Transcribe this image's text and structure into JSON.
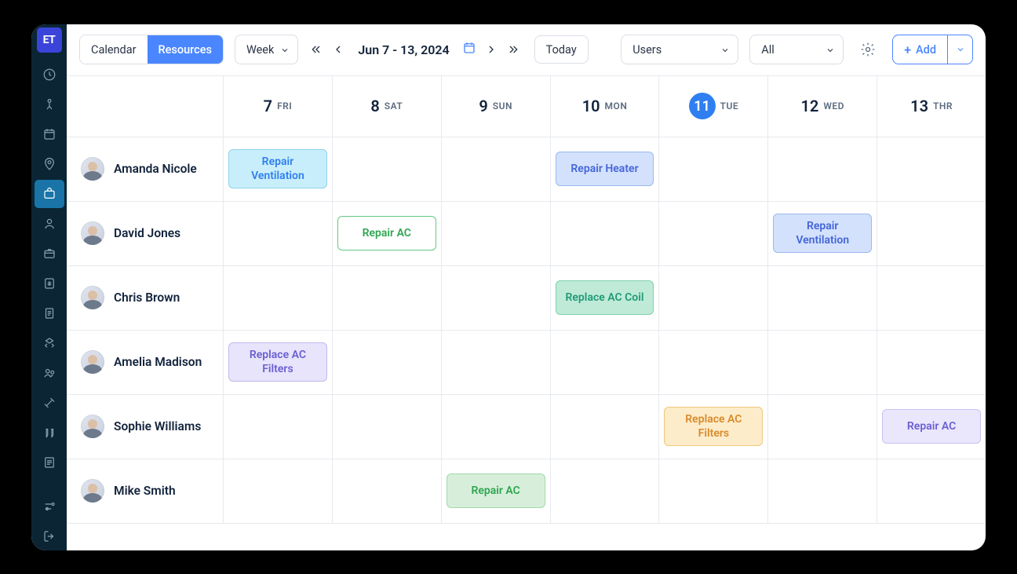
{
  "brand": "ET",
  "viewToggle": {
    "calendar": "Calendar",
    "resources": "Resources"
  },
  "rangeSelector": "Week",
  "dateRange": "Jun 7 - 13, 2024",
  "todayLabel": "Today",
  "filter1": "Users",
  "filter2": "All",
  "addLabel": "Add",
  "days": [
    {
      "num": "7",
      "lbl": "FRI",
      "today": false
    },
    {
      "num": "8",
      "lbl": "SAT",
      "today": false
    },
    {
      "num": "9",
      "lbl": "SUN",
      "today": false
    },
    {
      "num": "10",
      "lbl": "MON",
      "today": false
    },
    {
      "num": "11",
      "lbl": "TUE",
      "today": true
    },
    {
      "num": "12",
      "lbl": "WED",
      "today": false
    },
    {
      "num": "13",
      "lbl": "THR",
      "today": false
    }
  ],
  "rows": [
    {
      "name": "Amanda Nicole",
      "cells": [
        {
          "label": "Repair Ventilation",
          "style": "s-cyan"
        },
        null,
        null,
        {
          "label": "Repair Heater",
          "style": "s-blue"
        },
        null,
        null,
        null
      ]
    },
    {
      "name": "David Jones",
      "cells": [
        null,
        {
          "label": "Repair AC",
          "style": "s-greenO"
        },
        null,
        null,
        null,
        {
          "label": "Repair Ventilation",
          "style": "s-blue"
        },
        null
      ]
    },
    {
      "name": "Chris Brown",
      "cells": [
        null,
        null,
        null,
        {
          "label": "Replace AC Coil",
          "style": "s-teal"
        },
        null,
        null,
        null
      ]
    },
    {
      "name": "Amelia Madison",
      "cells": [
        {
          "label": "Replace AC Filters",
          "style": "s-violet"
        },
        null,
        null,
        null,
        null,
        null,
        null
      ]
    },
    {
      "name": "Sophie Williams",
      "cells": [
        null,
        null,
        null,
        null,
        {
          "label": "Replace AC Filters",
          "style": "s-orange"
        },
        null,
        {
          "label": "Repair AC",
          "style": "s-lav"
        }
      ]
    },
    {
      "name": "Mike Smith",
      "cells": [
        null,
        null,
        {
          "label": "Repair AC",
          "style": "s-green2"
        },
        null,
        null,
        null,
        null
      ]
    }
  ]
}
